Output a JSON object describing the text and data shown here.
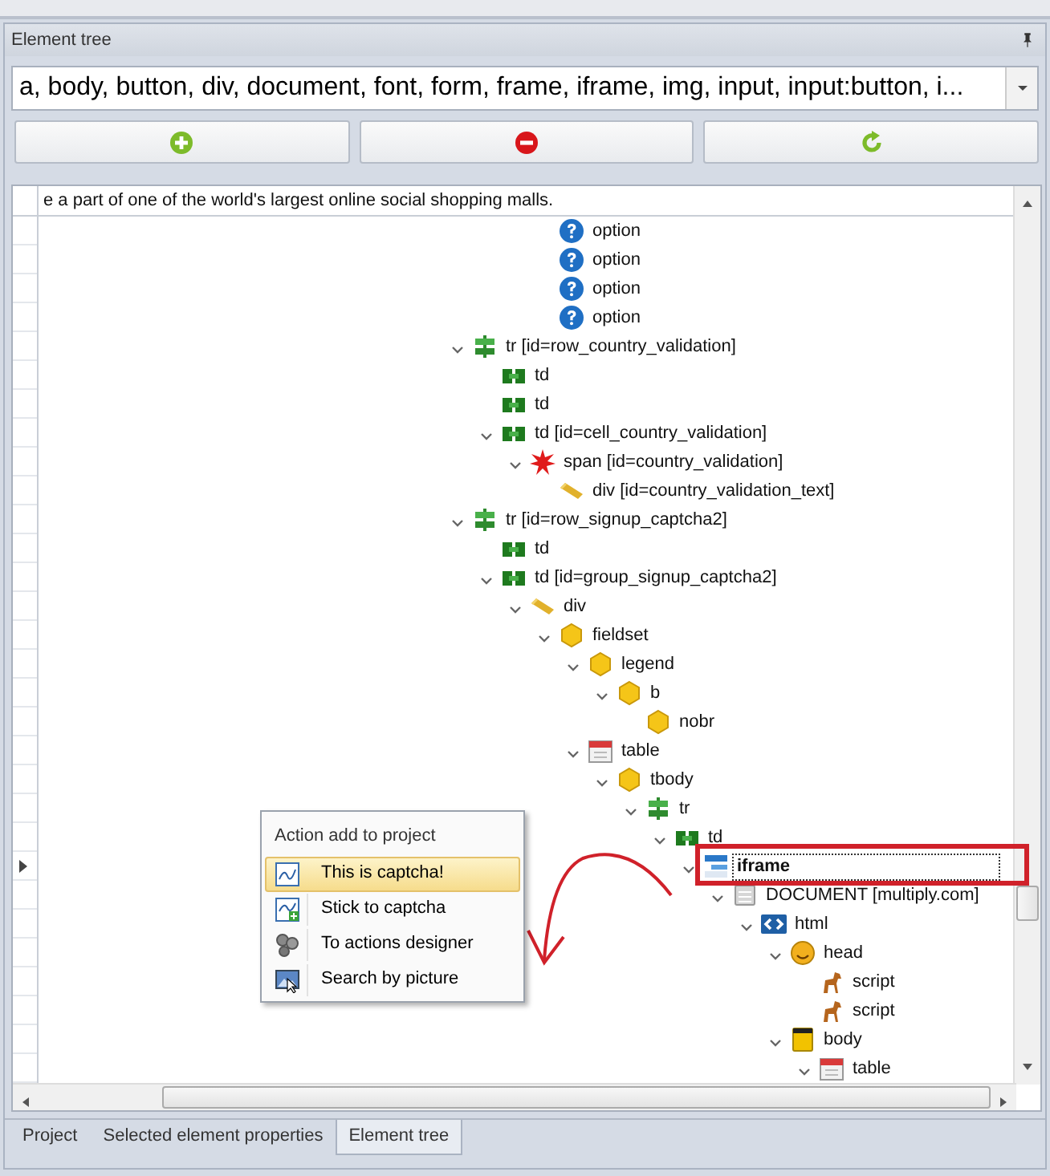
{
  "panel": {
    "title": "Element tree"
  },
  "filter": {
    "value": "a, body, button, div, document, font, form, frame, iframe, img, input, input:button, i..."
  },
  "toolbar": [
    {
      "kind": "add"
    },
    {
      "kind": "remove"
    },
    {
      "kind": "refresh"
    }
  ],
  "grid_header": "e a part of one of the world's largest online social shopping malls.",
  "tree": [
    {
      "children": [
        {
          "children": [
            {
              "children": [
                {
                  "label": "option",
                  "kind": "option",
                  "selected": false
                },
                {
                  "label": "option",
                  "kind": "option",
                  "selected": false
                },
                {
                  "label": "option",
                  "kind": "option",
                  "selected": false
                },
                {
                  "label": "option",
                  "kind": "option",
                  "selected": false
                }
              ]
            }
          ]
        }
      ]
    },
    {
      "label": "tr [id=row_country_validation]",
      "kind": "row",
      "selected": false,
      "expanded": true,
      "children": [
        {
          "label": "td",
          "kind": "cell",
          "selected": false
        },
        {
          "label": "td",
          "kind": "cell",
          "selected": false
        },
        {
          "label": "td [id=cell_country_validation]",
          "kind": "cell",
          "selected": false,
          "expanded": true,
          "children": [
            {
              "label": "span [id=country_validation]",
              "kind": "burst",
              "selected": false,
              "expanded": true,
              "children": [
                {
                  "label": "div [id=country_validation_text]",
                  "kind": "bar",
                  "selected": false
                }
              ]
            }
          ]
        }
      ]
    },
    {
      "label": "tr [id=row_signup_captcha2]",
      "kind": "row",
      "selected": false,
      "expanded": true,
      "children": [
        {
          "label": "td",
          "kind": "cell",
          "selected": false
        },
        {
          "label": "td [id=group_signup_captcha2]",
          "kind": "cell",
          "selected": false,
          "expanded": true,
          "children": [
            {
              "label": "div",
              "kind": "bar",
              "selected": false,
              "expanded": true,
              "children": [
                {
                  "label": "fieldset",
                  "kind": "hex",
                  "selected": false,
                  "expanded": true,
                  "children": [
                    {
                      "label": "legend",
                      "kind": "hex",
                      "selected": false,
                      "expanded": true,
                      "children": [
                        {
                          "label": "b",
                          "kind": "hex",
                          "selected": false,
                          "expanded": true,
                          "children": [
                            {
                              "label": "nobr",
                              "kind": "hex",
                              "selected": false
                            }
                          ]
                        }
                      ]
                    },
                    {
                      "label": "table",
                      "kind": "calendar",
                      "selected": false,
                      "expanded": true,
                      "children": [
                        {
                          "label": "tbody",
                          "kind": "hex",
                          "selected": false,
                          "expanded": true,
                          "children": [
                            {
                              "label": "tr",
                              "kind": "row",
                              "selected": false,
                              "expanded": true,
                              "children": [
                                {
                                  "label": "td",
                                  "kind": "cell",
                                  "selected": false,
                                  "expanded": true,
                                  "children": [
                                    {
                                      "label": "iframe",
                                      "kind": "window",
                                      "selected": true,
                                      "expanded": true,
                                      "children": [
                                        {
                                          "label": "DOCUMENT [multiply.com]",
                                          "kind": "document",
                                          "selected": false,
                                          "expanded": true,
                                          "children": [
                                            {
                                              "label": "html",
                                              "kind": "code",
                                              "selected": false,
                                              "expanded": true,
                                              "children": [
                                                {
                                                  "label": "head",
                                                  "kind": "smiley",
                                                  "selected": false,
                                                  "expanded": true,
                                                  "children": [
                                                    {
                                                      "label": "script",
                                                      "kind": "horse",
                                                      "selected": false
                                                    },
                                                    {
                                                      "label": "script",
                                                      "kind": "horse",
                                                      "selected": false
                                                    }
                                                  ]
                                                },
                                                {
                                                  "label": "body",
                                                  "kind": "book",
                                                  "selected": false,
                                                  "expanded": true,
                                                  "children": [
                                                    {
                                                      "label": "table",
                                                      "kind": "calendar",
                                                      "selected": false,
                                                      "expanded": true
                                                    }
                                                  ]
                                                }
                                              ]
                                            }
                                          ]
                                        }
                                      ]
                                    }
                                  ]
                                }
                              ]
                            }
                          ]
                        }
                      ]
                    }
                  ]
                }
              ]
            }
          ]
        }
      ]
    }
  ],
  "context_menu": {
    "title": "Action add to project",
    "items": [
      {
        "label": "This is captcha!",
        "kind": "captcha",
        "selected": true
      },
      {
        "label": "Stick to captcha",
        "kind": "captcha-add",
        "selected": false
      },
      {
        "label": "To actions designer",
        "kind": "gears",
        "selected": false
      },
      {
        "label": "Search by picture",
        "kind": "picture-cursor",
        "selected": false
      }
    ]
  },
  "tabs": [
    {
      "label": "Project",
      "selected": false
    },
    {
      "label": "Selected element properties",
      "selected": false
    },
    {
      "label": "Element tree",
      "selected": true
    }
  ]
}
